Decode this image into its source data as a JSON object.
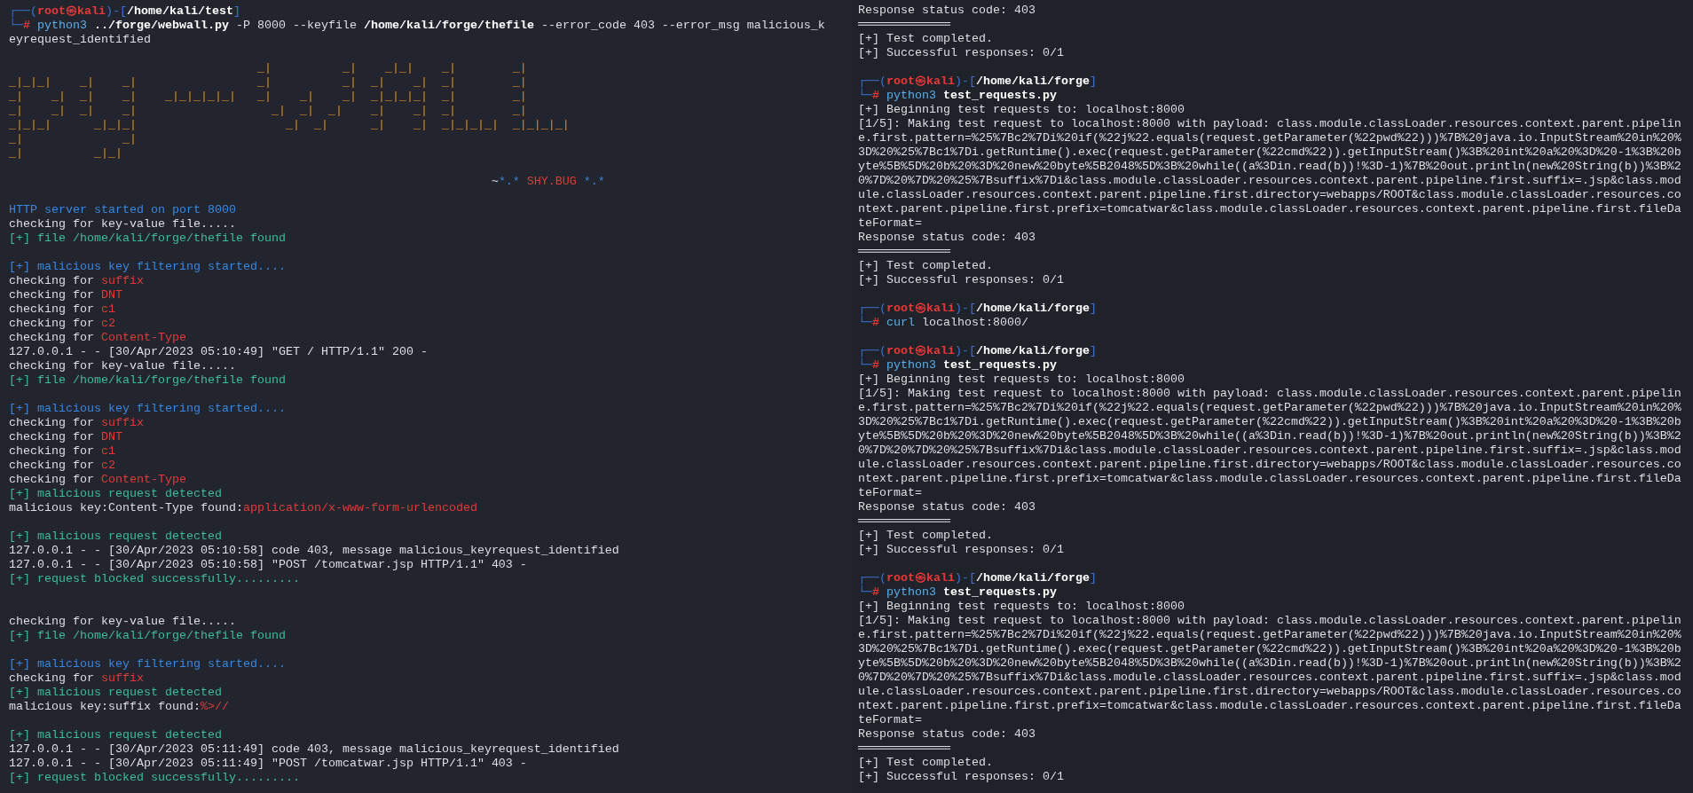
{
  "left_pane": {
    "lines": [
      {
        "kind": "text",
        "segments": [
          {
            "text": "┌──(",
            "kind": "frame"
          },
          {
            "text": "root㉿kali",
            "kind": "redbold"
          },
          {
            "text": ")-[",
            "kind": "frame"
          },
          {
            "text": "/home/kali/test",
            "kind": "bold"
          },
          {
            "text": "]",
            "kind": "frame"
          }
        ]
      },
      {
        "kind": "text",
        "segments": [
          {
            "text": "└─",
            "kind": "frame"
          },
          {
            "text": "#",
            "kind": "redbold"
          },
          {
            "text": " python3",
            "kind": "cyan"
          },
          {
            "text": " ../forge/webwall.py",
            "kind": "bold"
          },
          {
            "text": " -P 8000 --keyfile",
            "kind": "plain"
          },
          {
            "text": " /home/kali/forge/thefile",
            "kind": "bold"
          },
          {
            "text": " --error_code 403 --error_msg malicious_keyrequest_identified",
            "kind": "plain"
          }
        ]
      },
      {
        "kind": "blank"
      },
      {
        "kind": "art",
        "text": "                                   _|          _|    _|_|    _|        _|"
      },
      {
        "kind": "art",
        "text": "_|_|_|    _|    _|                 _|          _|  _|    _|  _|        _|"
      },
      {
        "kind": "art",
        "text": "_|    _|  _|    _|    _|_|_|_|_|   _|    _|    _|  _|_|_|_|  _|        _|"
      },
      {
        "kind": "art",
        "text": "_|    _|  _|    _|                   _|  _|  _|    _|    _|  _|        _|"
      },
      {
        "kind": "art",
        "text": "_|_|_|      _|_|_|                     _|  _|      _|    _|  _|_|_|_|  _|_|_|_|"
      },
      {
        "kind": "art",
        "text": "_|              _|"
      },
      {
        "kind": "art",
        "text": "_|          _|_|"
      },
      {
        "kind": "blank"
      },
      {
        "kind": "tagline",
        "segments": [
          {
            "text": "~",
            "kind": "plain"
          },
          {
            "text": "*.*",
            "kind": "blue"
          },
          {
            "text": " SHY.BUG ",
            "kind": "red"
          },
          {
            "text": "*.*",
            "kind": "blue"
          }
        ]
      },
      {
        "kind": "blank"
      },
      {
        "kind": "text",
        "segments": [
          {
            "text": "HTTP server started on port 8000",
            "kind": "blue"
          }
        ]
      },
      {
        "kind": "text",
        "segments": [
          {
            "text": "checking for key-value file.....",
            "kind": "plain"
          }
        ]
      },
      {
        "kind": "text",
        "segments": [
          {
            "text": "[+] file /home/kali/forge/thefile found",
            "kind": "green"
          }
        ]
      },
      {
        "kind": "blank"
      },
      {
        "kind": "text",
        "segments": [
          {
            "text": "[+] malicious key filtering started....",
            "kind": "blue"
          }
        ]
      },
      {
        "kind": "text",
        "segments": [
          {
            "text": "checking for ",
            "kind": "plain"
          },
          {
            "text": "suffix",
            "kind": "red"
          }
        ]
      },
      {
        "kind": "text",
        "segments": [
          {
            "text": "checking for ",
            "kind": "plain"
          },
          {
            "text": "DNT",
            "kind": "red"
          }
        ]
      },
      {
        "kind": "text",
        "segments": [
          {
            "text": "checking for ",
            "kind": "plain"
          },
          {
            "text": "c1",
            "kind": "red"
          }
        ]
      },
      {
        "kind": "text",
        "segments": [
          {
            "text": "checking for ",
            "kind": "plain"
          },
          {
            "text": "c2",
            "kind": "red"
          }
        ]
      },
      {
        "kind": "text",
        "segments": [
          {
            "text": "checking for ",
            "kind": "plain"
          },
          {
            "text": "Content-Type",
            "kind": "red"
          }
        ]
      },
      {
        "kind": "text",
        "segments": [
          {
            "text": "127.0.0.1 - - [30/Apr/2023 05:10:49] \"GET / HTTP/1.1\" 200 -",
            "kind": "plain"
          }
        ]
      },
      {
        "kind": "text",
        "segments": [
          {
            "text": "checking for key-value file.....",
            "kind": "plain"
          }
        ]
      },
      {
        "kind": "text",
        "segments": [
          {
            "text": "[+] file /home/kali/forge/thefile found",
            "kind": "green"
          }
        ]
      },
      {
        "kind": "blank"
      },
      {
        "kind": "text",
        "segments": [
          {
            "text": "[+] malicious key filtering started....",
            "kind": "blue"
          }
        ]
      },
      {
        "kind": "text",
        "segments": [
          {
            "text": "checking for ",
            "kind": "plain"
          },
          {
            "text": "suffix",
            "kind": "red"
          }
        ]
      },
      {
        "kind": "text",
        "segments": [
          {
            "text": "checking for ",
            "kind": "plain"
          },
          {
            "text": "DNT",
            "kind": "red"
          }
        ]
      },
      {
        "kind": "text",
        "segments": [
          {
            "text": "checking for ",
            "kind": "plain"
          },
          {
            "text": "c1",
            "kind": "red"
          }
        ]
      },
      {
        "kind": "text",
        "segments": [
          {
            "text": "checking for ",
            "kind": "plain"
          },
          {
            "text": "c2",
            "kind": "red"
          }
        ]
      },
      {
        "kind": "text",
        "segments": [
          {
            "text": "checking for ",
            "kind": "plain"
          },
          {
            "text": "Content-Type",
            "kind": "red"
          }
        ]
      },
      {
        "kind": "text",
        "segments": [
          {
            "text": "[+] malicious request detected",
            "kind": "green"
          }
        ]
      },
      {
        "kind": "text",
        "segments": [
          {
            "text": "malicious key:Content-Type found:",
            "kind": "plain"
          },
          {
            "text": "application/x-www-form-urlencoded",
            "kind": "red"
          }
        ]
      },
      {
        "kind": "blank"
      },
      {
        "kind": "text",
        "segments": [
          {
            "text": "[+] malicious request detected",
            "kind": "green"
          }
        ]
      },
      {
        "kind": "text",
        "segments": [
          {
            "text": "127.0.0.1 - - [30/Apr/2023 05:10:58] code 403, message malicious_keyrequest_identified",
            "kind": "plain"
          }
        ]
      },
      {
        "kind": "text",
        "segments": [
          {
            "text": "127.0.0.1 - - [30/Apr/2023 05:10:58] \"POST /tomcatwar.jsp HTTP/1.1\" 403 -",
            "kind": "plain"
          }
        ]
      },
      {
        "kind": "text",
        "segments": [
          {
            "text": "[+] request blocked successfully.........",
            "kind": "green"
          }
        ]
      },
      {
        "kind": "blank"
      },
      {
        "kind": "blank"
      },
      {
        "kind": "text",
        "segments": [
          {
            "text": "checking for key-value file.....",
            "kind": "plain"
          }
        ]
      },
      {
        "kind": "text",
        "segments": [
          {
            "text": "[+] file /home/kali/forge/thefile found",
            "kind": "green"
          }
        ]
      },
      {
        "kind": "blank"
      },
      {
        "kind": "text",
        "segments": [
          {
            "text": "[+] malicious key filtering started....",
            "kind": "blue"
          }
        ]
      },
      {
        "kind": "text",
        "segments": [
          {
            "text": "checking for ",
            "kind": "plain"
          },
          {
            "text": "suffix",
            "kind": "red"
          }
        ]
      },
      {
        "kind": "text",
        "segments": [
          {
            "text": "[+] malicious request detected",
            "kind": "green"
          }
        ]
      },
      {
        "kind": "text",
        "segments": [
          {
            "text": "malicious key:suffix found:",
            "kind": "plain"
          },
          {
            "text": "%>//",
            "kind": "red"
          }
        ]
      },
      {
        "kind": "blank"
      },
      {
        "kind": "text",
        "segments": [
          {
            "text": "[+] malicious request detected",
            "kind": "green"
          }
        ]
      },
      {
        "kind": "text",
        "segments": [
          {
            "text": "127.0.0.1 - - [30/Apr/2023 05:11:49] code 403, message malicious_keyrequest_identified",
            "kind": "plain"
          }
        ]
      },
      {
        "kind": "text",
        "segments": [
          {
            "text": "127.0.0.1 - - [30/Apr/2023 05:11:49] \"POST /tomcatwar.jsp HTTP/1.1\" 403 -",
            "kind": "plain"
          }
        ]
      },
      {
        "kind": "text",
        "segments": [
          {
            "text": "[+] request blocked successfully.........",
            "kind": "green"
          }
        ]
      }
    ]
  },
  "right_pane": {
    "lines": [
      {
        "kind": "text",
        "segments": [
          {
            "text": "Response status code: 403",
            "kind": "plain"
          }
        ]
      },
      {
        "kind": "text",
        "segments": [
          {
            "text": "═════════════",
            "kind": "plain"
          }
        ]
      },
      {
        "kind": "text",
        "segments": [
          {
            "text": "[+] Test completed.",
            "kind": "plain"
          }
        ]
      },
      {
        "kind": "text",
        "segments": [
          {
            "text": "[+] Successful responses: 0/1",
            "kind": "plain"
          }
        ]
      },
      {
        "kind": "blank"
      },
      {
        "kind": "text",
        "segments": [
          {
            "text": "┌──(",
            "kind": "frame"
          },
          {
            "text": "root㉿kali",
            "kind": "redbold"
          },
          {
            "text": ")-[",
            "kind": "frame"
          },
          {
            "text": "/home/kali/forge",
            "kind": "bold"
          },
          {
            "text": "]",
            "kind": "frame"
          }
        ]
      },
      {
        "kind": "text",
        "segments": [
          {
            "text": "└─",
            "kind": "frame"
          },
          {
            "text": "#",
            "kind": "redbold"
          },
          {
            "text": " python3",
            "kind": "cyan"
          },
          {
            "text": " test_requests.py",
            "kind": "bold"
          }
        ]
      },
      {
        "kind": "text",
        "segments": [
          {
            "text": "[+] Beginning test requests to: localhost:8000",
            "kind": "plain"
          }
        ]
      },
      {
        "kind": "text",
        "segments": [
          {
            "text": "[1/5]: Making test request to localhost:8000 with payload: class.module.classLoader.resources.context.parent.pipeline.first.pattern=%25%7Bc2%7Di%20if(%22j%22.equals(request.getParameter(%22pwd%22)))%7B%20java.io.InputStream%20in%20%3D%20%25%7Bc1%7Di.getRuntime().exec(request.getParameter(%22cmd%22)).getInputStream()%3B%20int%20a%20%3D%20-1%3B%20byte%5B%5D%20b%20%3D%20new%20byte%5B2048%5D%3B%20while((a%3Din.read(b))!%3D-1)%7B%20out.println(new%20String(b))%3B%20%7D%20%7D%20%25%7Bsuffix%7Di&class.module.classLoader.resources.context.parent.pipeline.first.suffix=.jsp&class.module.classLoader.resources.context.parent.pipeline.first.directory=webapps/ROOT&class.module.classLoader.resources.context.parent.pipeline.first.prefix=tomcatwar&class.module.classLoader.resources.context.parent.pipeline.first.fileDateFormat=",
            "kind": "plain"
          }
        ]
      },
      {
        "kind": "text",
        "segments": [
          {
            "text": "Response status code: 403",
            "kind": "plain"
          }
        ]
      },
      {
        "kind": "text",
        "segments": [
          {
            "text": "═════════════",
            "kind": "plain"
          }
        ]
      },
      {
        "kind": "text",
        "segments": [
          {
            "text": "[+] Test completed.",
            "kind": "plain"
          }
        ]
      },
      {
        "kind": "text",
        "segments": [
          {
            "text": "[+] Successful responses: 0/1",
            "kind": "plain"
          }
        ]
      },
      {
        "kind": "blank"
      },
      {
        "kind": "text",
        "segments": [
          {
            "text": "┌──(",
            "kind": "frame"
          },
          {
            "text": "root㉿kali",
            "kind": "redbold"
          },
          {
            "text": ")-[",
            "kind": "frame"
          },
          {
            "text": "/home/kali/forge",
            "kind": "bold"
          },
          {
            "text": "]",
            "kind": "frame"
          }
        ]
      },
      {
        "kind": "text",
        "segments": [
          {
            "text": "└─",
            "kind": "frame"
          },
          {
            "text": "#",
            "kind": "redbold"
          },
          {
            "text": " curl",
            "kind": "cyan"
          },
          {
            "text": " localhost:8000/",
            "kind": "plain"
          }
        ]
      },
      {
        "kind": "blank"
      },
      {
        "kind": "text",
        "segments": [
          {
            "text": "┌──(",
            "kind": "frame"
          },
          {
            "text": "root㉿kali",
            "kind": "redbold"
          },
          {
            "text": ")-[",
            "kind": "frame"
          },
          {
            "text": "/home/kali/forge",
            "kind": "bold"
          },
          {
            "text": "]",
            "kind": "frame"
          }
        ]
      },
      {
        "kind": "text",
        "segments": [
          {
            "text": "└─",
            "kind": "frame"
          },
          {
            "text": "#",
            "kind": "redbold"
          },
          {
            "text": " python3",
            "kind": "cyan"
          },
          {
            "text": " test_requests.py",
            "kind": "bold"
          }
        ]
      },
      {
        "kind": "text",
        "segments": [
          {
            "text": "[+] Beginning test requests to: localhost:8000",
            "kind": "plain"
          }
        ]
      },
      {
        "kind": "text",
        "segments": [
          {
            "text": "[1/5]: Making test request to localhost:8000 with payload: class.module.classLoader.resources.context.parent.pipeline.first.pattern=%25%7Bc2%7Di%20if(%22j%22.equals(request.getParameter(%22pwd%22)))%7B%20java.io.InputStream%20in%20%3D%20%25%7Bc1%7Di.getRuntime().exec(request.getParameter(%22cmd%22)).getInputStream()%3B%20int%20a%20%3D%20-1%3B%20byte%5B%5D%20b%20%3D%20new%20byte%5B2048%5D%3B%20while((a%3Din.read(b))!%3D-1)%7B%20out.println(new%20String(b))%3B%20%7D%20%7D%20%25%7Bsuffix%7Di&class.module.classLoader.resources.context.parent.pipeline.first.suffix=.jsp&class.module.classLoader.resources.context.parent.pipeline.first.directory=webapps/ROOT&class.module.classLoader.resources.context.parent.pipeline.first.prefix=tomcatwar&class.module.classLoader.resources.context.parent.pipeline.first.fileDateFormat=",
            "kind": "plain"
          }
        ]
      },
      {
        "kind": "text",
        "segments": [
          {
            "text": "Response status code: 403",
            "kind": "plain"
          }
        ]
      },
      {
        "kind": "text",
        "segments": [
          {
            "text": "═════════════",
            "kind": "plain"
          }
        ]
      },
      {
        "kind": "text",
        "segments": [
          {
            "text": "[+] Test completed.",
            "kind": "plain"
          }
        ]
      },
      {
        "kind": "text",
        "segments": [
          {
            "text": "[+] Successful responses: 0/1",
            "kind": "plain"
          }
        ]
      },
      {
        "kind": "blank"
      },
      {
        "kind": "text",
        "segments": [
          {
            "text": "┌──(",
            "kind": "frame"
          },
          {
            "text": "root㉿kali",
            "kind": "redbold"
          },
          {
            "text": ")-[",
            "kind": "frame"
          },
          {
            "text": "/home/kali/forge",
            "kind": "bold"
          },
          {
            "text": "]",
            "kind": "frame"
          }
        ]
      },
      {
        "kind": "text",
        "segments": [
          {
            "text": "└─",
            "kind": "frame"
          },
          {
            "text": "#",
            "kind": "redbold"
          },
          {
            "text": " python3",
            "kind": "cyan"
          },
          {
            "text": " test_requests.py",
            "kind": "bold"
          }
        ]
      },
      {
        "kind": "text",
        "segments": [
          {
            "text": "[+] Beginning test requests to: localhost:8000",
            "kind": "plain"
          }
        ]
      },
      {
        "kind": "text",
        "segments": [
          {
            "text": "[1/5]: Making test request to localhost:8000 with payload: class.module.classLoader.resources.context.parent.pipeline.first.pattern=%25%7Bc2%7Di%20if(%22j%22.equals(request.getParameter(%22pwd%22)))%7B%20java.io.InputStream%20in%20%3D%20%25%7Bc1%7Di.getRuntime().exec(request.getParameter(%22cmd%22)).getInputStream()%3B%20int%20a%20%3D%20-1%3B%20byte%5B%5D%20b%20%3D%20new%20byte%5B2048%5D%3B%20while((a%3Din.read(b))!%3D-1)%7B%20out.println(new%20String(b))%3B%20%7D%20%7D%20%25%7Bsuffix%7Di&class.module.classLoader.resources.context.parent.pipeline.first.suffix=.jsp&class.module.classLoader.resources.context.parent.pipeline.first.directory=webapps/ROOT&class.module.classLoader.resources.context.parent.pipeline.first.prefix=tomcatwar&class.module.classLoader.resources.context.parent.pipeline.first.fileDateFormat=",
            "kind": "plain"
          }
        ]
      },
      {
        "kind": "text",
        "segments": [
          {
            "text": "Response status code: 403",
            "kind": "plain"
          }
        ]
      },
      {
        "kind": "text",
        "segments": [
          {
            "text": "═════════════",
            "kind": "plain"
          }
        ]
      },
      {
        "kind": "text",
        "segments": [
          {
            "text": "[+] Test completed.",
            "kind": "plain"
          }
        ]
      },
      {
        "kind": "text",
        "segments": [
          {
            "text": "[+] Successful responses: 0/1",
            "kind": "plain"
          }
        ]
      }
    ]
  }
}
